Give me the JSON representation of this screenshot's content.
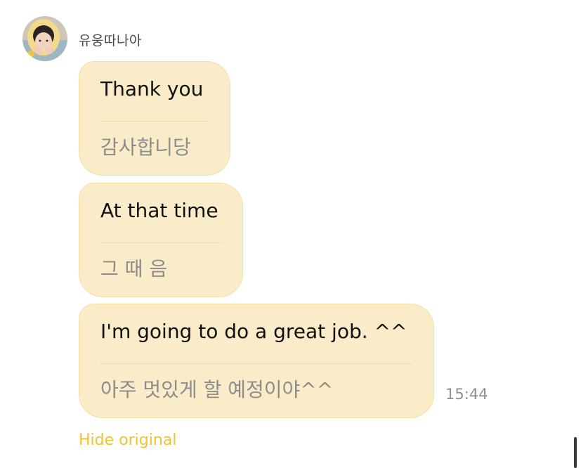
{
  "sender": {
    "name": "유웅따나아",
    "avatar_icon": "profile-photo-avatar"
  },
  "messages": [
    {
      "translated": "Thank you",
      "original": "감사합니당"
    },
    {
      "translated": "At that time",
      "original": "그 때 음"
    },
    {
      "translated": "I'm going to do a great job. ^^",
      "original": "아주 멋있게 할 예정이야^^"
    }
  ],
  "timestamp": "15:44",
  "actions": {
    "hide_original_label": "Hide original"
  },
  "colors": {
    "bubble_background": "#fbecc9",
    "bubble_border": "#f5dfa4",
    "accent": "#f1c232"
  }
}
